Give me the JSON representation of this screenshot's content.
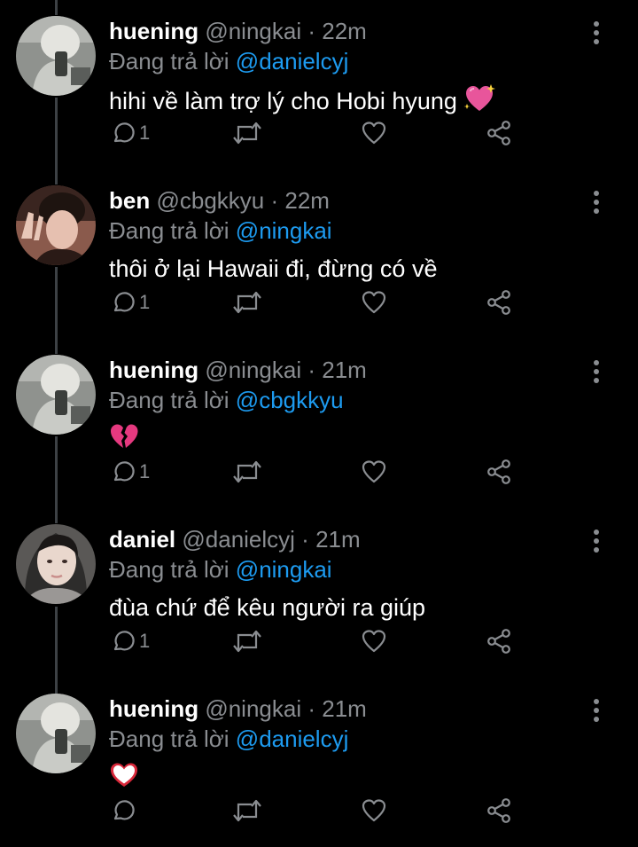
{
  "colors": {
    "background": "#000000",
    "name": "#ffffff",
    "secondary": "#8a8d91",
    "mention": "#1d9bf0",
    "thread_line": "#3d4145"
  },
  "replying_label": "Đang trả lời",
  "tweets": [
    {
      "name": "huening",
      "handle": "@ningkai",
      "dot": "·",
      "time": "22m",
      "reply_to": "@danielcyj",
      "text": "hihi về làm trợ lý cho Hobi hyung",
      "emoji": "sparkling-heart",
      "reply_count": "1"
    },
    {
      "name": "ben",
      "handle": "@cbgkkyu",
      "dot": "·",
      "time": "22m",
      "reply_to": "@ningkai",
      "text": "thôi ở lại Hawaii đi, đừng có về",
      "emoji": "",
      "reply_count": "1"
    },
    {
      "name": "huening",
      "handle": "@ningkai",
      "dot": "·",
      "time": "21m",
      "reply_to": "@cbgkkyu",
      "text": "",
      "emoji": "broken-heart",
      "reply_count": "1"
    },
    {
      "name": "daniel",
      "handle": "@danielcyj",
      "dot": "·",
      "time": "21m",
      "reply_to": "@ningkai",
      "text": "đùa chứ để kêu người ra giúp",
      "emoji": "",
      "reply_count": "1"
    },
    {
      "name": "huening",
      "handle": "@ningkai",
      "dot": "·",
      "time": "21m",
      "reply_to": "@danielcyj",
      "text": "",
      "emoji": "white-heart",
      "reply_count": ""
    }
  ]
}
